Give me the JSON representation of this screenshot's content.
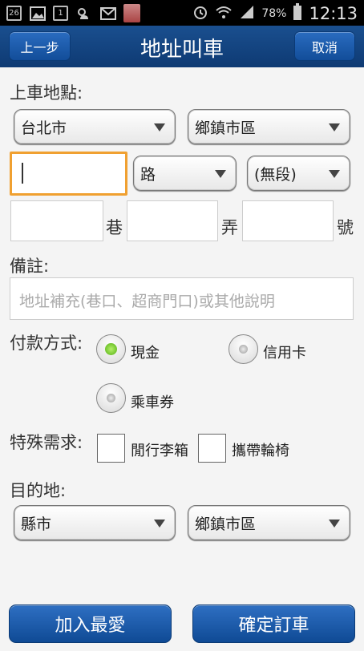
{
  "statusbar": {
    "date_badge": "26",
    "calendar_badge": "1",
    "battery": "78%",
    "time": "12:13"
  },
  "header": {
    "back_label": "上一步",
    "title": "地址叫車",
    "cancel_label": "取消"
  },
  "pickup": {
    "label": "上車地點:",
    "city": "台北市",
    "district": "鄉鎮市區",
    "road_type": "路",
    "section": "(無段)",
    "lane_unit": "巷",
    "alley_unit": "弄",
    "number_unit": "號"
  },
  "notes": {
    "label": "備註:",
    "placeholder": "地址補充(巷口、超商門口)或其他說明"
  },
  "payment": {
    "label": "付款方式:",
    "options": [
      "現金",
      "信用卡",
      "乘車券"
    ],
    "selected": "現金"
  },
  "special": {
    "label": "特殊需求:",
    "options": [
      "閒行李箱",
      "攜帶輪椅"
    ]
  },
  "destination": {
    "label": "目的地:",
    "city": "縣市",
    "district": "鄉鎮市區"
  },
  "footer": {
    "favorite_label": "加入最愛",
    "confirm_label": "確定訂車"
  }
}
